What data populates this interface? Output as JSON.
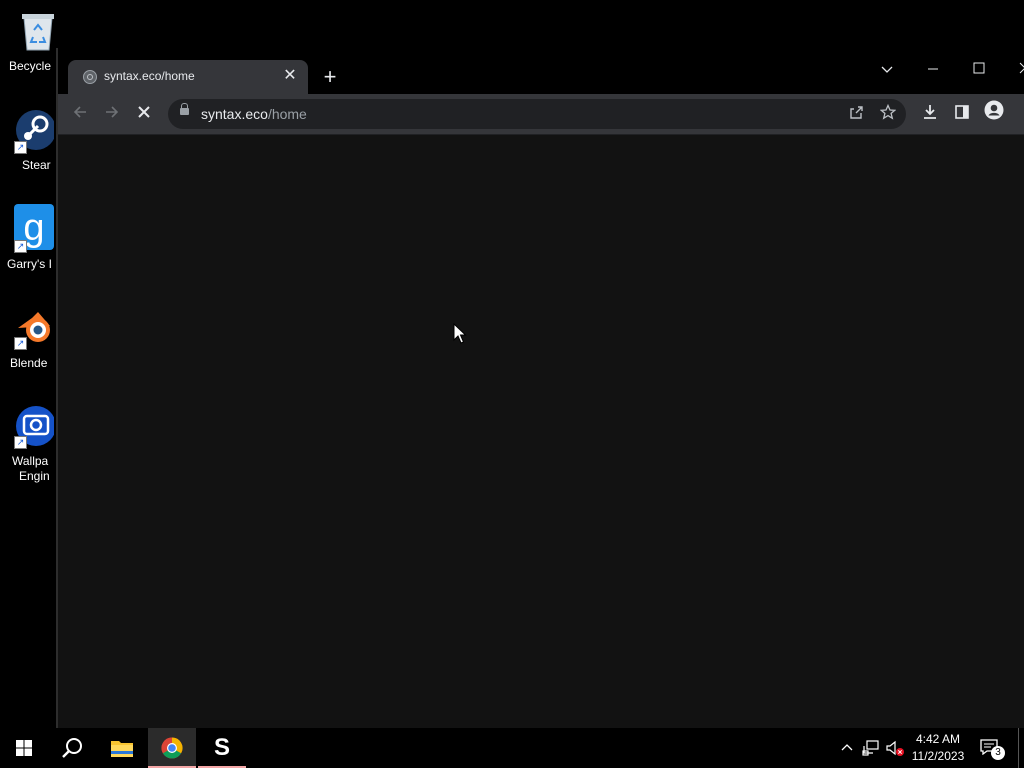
{
  "desktop": {
    "icons": [
      {
        "label": "Becycle",
        "icon": "recycle-bin-icon"
      },
      {
        "label": "Stear",
        "icon": "steam-icon"
      },
      {
        "label": "Garry's I",
        "icon": "garrys-mod-icon"
      },
      {
        "label": "Blende",
        "icon": "blender-icon"
      },
      {
        "label": "Wallpa",
        "label2": "Engin",
        "icon": "wallpaper-engine-icon"
      }
    ]
  },
  "browser": {
    "tab": {
      "title": "syntax.eco/home",
      "close": "✕"
    },
    "new_tab": "+",
    "address": {
      "host": "syntax.eco",
      "path": "/home"
    },
    "status": "loading"
  },
  "taskbar": {
    "items": [
      "start-icon",
      "search-icon",
      "file-explorer-icon",
      "chrome-icon",
      "syntax-icon"
    ],
    "syntax_label": "S",
    "clock": {
      "time": "4:42 AM",
      "date": "11/2/2023"
    },
    "notification_count": "3"
  },
  "colors": {
    "accent_underline": "#f4a6a6",
    "window_bg": "#121212",
    "toolbar_bg": "#35363a"
  }
}
